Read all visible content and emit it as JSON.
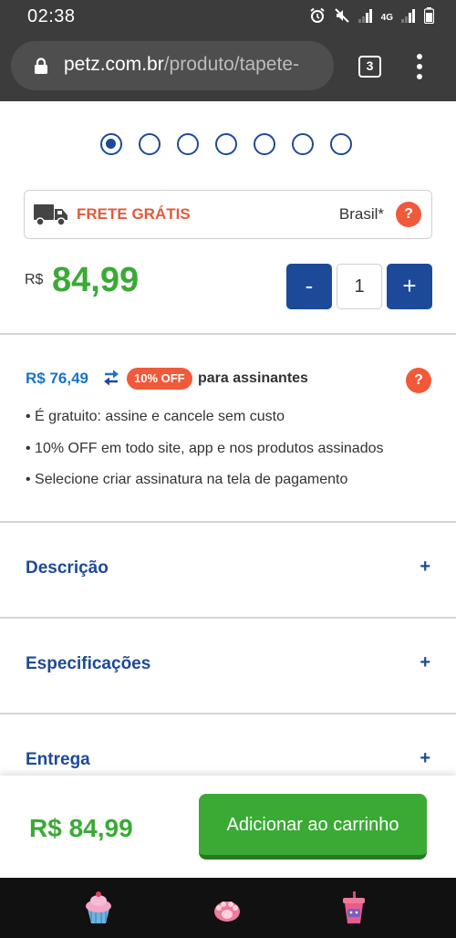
{
  "status_bar": {
    "time": "02:38",
    "network": "4G"
  },
  "browser": {
    "url_domain": "petz.com.br",
    "url_path": "/produto/tapete-",
    "tab_count": "3"
  },
  "carousel": {
    "dot_count": 7,
    "active_index": 0
  },
  "shipping": {
    "label": "FRETE GRÁTIS",
    "region": "Brasil*",
    "help": "?"
  },
  "price": {
    "currency": "R$",
    "value": "84,99"
  },
  "quantity": {
    "minus": "-",
    "value": "1",
    "plus": "+"
  },
  "subscription": {
    "price": "R$ 76,49",
    "badge": "10% OFF",
    "text": "para assinantes",
    "help": "?",
    "bullets": [
      "• É gratuito: assine e cancele sem custo",
      "• 10% OFF em todo site, app e nos produtos assinados",
      "• Selecione criar assinatura na tela de pagamento"
    ]
  },
  "accordion": [
    {
      "title": "Descrição",
      "icon": "+"
    },
    {
      "title": "Especificações",
      "icon": "+"
    },
    {
      "title": "Entrega",
      "icon": "+"
    }
  ],
  "sticky": {
    "price": "R$ 84,99",
    "button": "Adicionar ao carrinho"
  },
  "colors": {
    "brand_blue": "#1d4a98",
    "price_green": "#3aaa35",
    "accent_orange": "#f05a3a",
    "link_blue": "#1a74c4"
  },
  "nav_icons": [
    "cupcake-icon",
    "paw-icon",
    "cup-icon"
  ]
}
